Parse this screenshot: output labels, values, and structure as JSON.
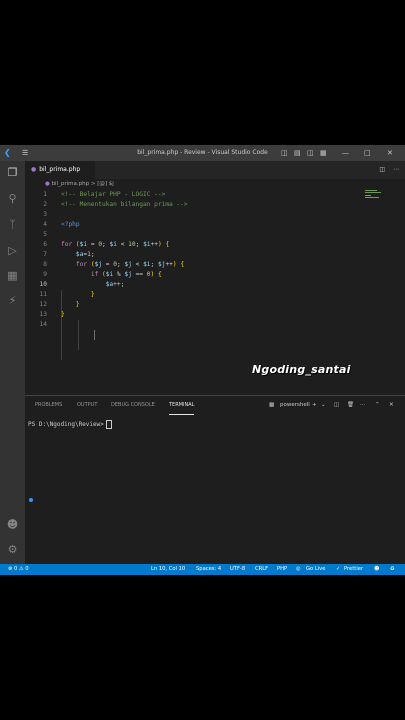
{
  "window": {
    "title": "bil_prima.php - Review - Visual Studio Code"
  },
  "tab": {
    "label": "bil_prima.php"
  },
  "breadcrumb": {
    "file": "bil_prima.php",
    "sep": ">",
    "symbol": "[@] $j"
  },
  "editor": {
    "line_numbers": [
      "1",
      "2",
      "3",
      "4",
      "5",
      "6",
      "7",
      "8",
      "9",
      "10",
      "11",
      "12",
      "13",
      "14"
    ],
    "lines": [
      "<!-- Belajar PHP - LOGIC -->",
      "<!-- Menentukan bilangan prima -->",
      "",
      "<?php",
      "",
      "for ($i = 0; $i < 10; $i++) {",
      "    $a=1;",
      "    for ($j = 0; $j < $i; $j++) {",
      "        if ($i % $j == 0) {",
      "            $a++;",
      "        }",
      "    }",
      "}",
      ""
    ]
  },
  "watermark": "Ngoding_santai",
  "panel": {
    "tabs": [
      "PROBLEMS",
      "OUTPUT",
      "DEBUG CONSOLE",
      "TERMINAL"
    ],
    "shell": "powershell",
    "prompt": "PS D:\\Ngoding\\Review>"
  },
  "status": {
    "problems": "⊗ 0 ⚠ 0",
    "position": "Ln 10, Col 10",
    "spaces": "Spaces: 4",
    "encoding": "UTF-8",
    "eol": "CRLF",
    "language": "PHP",
    "golive": "Go Live",
    "prettier": "Prettier"
  },
  "colors": {
    "accent": "#007acc",
    "editor_bg": "#1e1e1e",
    "titlebar": "#3c3c3c"
  }
}
